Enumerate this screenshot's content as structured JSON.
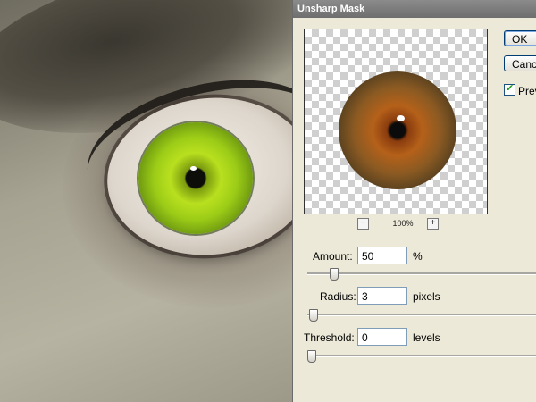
{
  "dialog": {
    "title": "Unsharp Mask",
    "zoom_label": "100%",
    "zoom_out_icon": "minus-icon",
    "zoom_in_icon": "plus-icon",
    "buttons": {
      "ok": "OK",
      "cancel": "Cancel"
    },
    "preview_checkbox": {
      "label": "Preview",
      "checked": true
    },
    "amount": {
      "label": "Amount:",
      "value": "50",
      "unit": "%",
      "slider_fraction": 0.1
    },
    "radius": {
      "label": "Radius:",
      "value": "3",
      "unit": "pixels",
      "slider_fraction": 0.012
    },
    "threshold": {
      "label": "Threshold:",
      "value": "0",
      "unit": "levels",
      "slider_fraction": 0.0
    }
  },
  "colors": {
    "dialog_bg": "#ece9d8",
    "titlebar": "#7a7a7a",
    "iris_green": "#b9e01f",
    "iris_brown": "#b5611a"
  }
}
